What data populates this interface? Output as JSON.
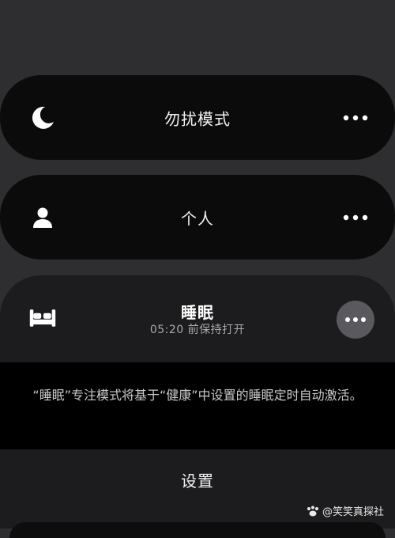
{
  "focus_modes": [
    {
      "label": "勿扰模式",
      "icon": "moon-icon"
    },
    {
      "label": "个人",
      "icon": "person-icon"
    }
  ],
  "sleep": {
    "title": "睡眠",
    "subtitle": "05:20 前保持打开",
    "icon": "bed-icon",
    "description": "“睡眠”专注模式将基于“健康”中设置的睡眠定时自动激活。",
    "settings_label": "设置"
  },
  "watermark": "@笑笑真探社",
  "colors": {
    "background": "#2e2e30",
    "card": "#0b0b0b",
    "expanded_card": "#1c1c1e",
    "more_button_active": "#5a5a5e"
  }
}
